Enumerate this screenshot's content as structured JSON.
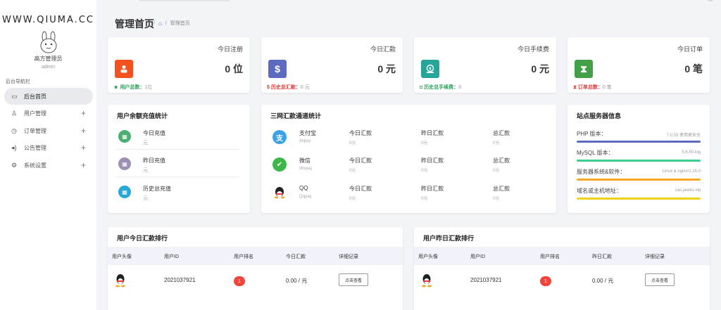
{
  "sidebar": {
    "brand": "WWW.QIUMA.CC",
    "admin_name": "高方管理员",
    "admin_role": "admin",
    "nav_caption": "后台导航栏",
    "items": [
      {
        "label": "后台首页",
        "icon": "monitor-icon"
      },
      {
        "label": "用户管理",
        "icon": "user-icon"
      },
      {
        "label": "订单管理",
        "icon": "clock-icon"
      },
      {
        "label": "公告管理",
        "icon": "speaker-icon"
      },
      {
        "label": "系统设置",
        "icon": "gear-icon"
      }
    ]
  },
  "header": {
    "title": "管理首页",
    "breadcrumb_sep": "/",
    "breadcrumb_current": "管理首页"
  },
  "stats": [
    {
      "label": "今日注册",
      "value": "0 位",
      "foot_key": "用户总数：",
      "foot_val": "1位",
      "color": "#f4511e",
      "foot_color": "#2e9e5b",
      "icon": "user-icon"
    },
    {
      "label": "今日汇款",
      "value": "0 元",
      "foot_key": "历史总汇款：",
      "foot_val": "0 元",
      "color": "#5c6bc0",
      "foot_color": "#e53935",
      "icon": "dollar-icon"
    },
    {
      "label": "今日手续费",
      "value": "0 元",
      "foot_key": "历史总手续费：",
      "foot_val": "0",
      "color": "#26a69a",
      "foot_color": "#2e9e5b",
      "icon": "money-icon"
    },
    {
      "label": "今日订单",
      "value": "0 笔",
      "foot_key": "订单总数：",
      "foot_val": "0 笔",
      "color": "#43a047",
      "foot_color": "#e53935",
      "icon": "hourglass-icon"
    }
  ],
  "recharge": {
    "title": "用户余额充值统计",
    "rows": [
      {
        "title": "今日充值",
        "sub": "元",
        "color": "#4caf72"
      },
      {
        "title": "昨日充值",
        "sub": "元",
        "color": "#9e8fb4"
      },
      {
        "title": "历史总充值",
        "sub": "元",
        "color": "#29a8d8"
      }
    ]
  },
  "payments": {
    "title": "三网汇款通道统计",
    "col_today": "今日汇款",
    "col_yesterday": "昨日汇款",
    "col_total": "总汇款",
    "rows": [
      {
        "name": "支付宝",
        "en": "Alipay",
        "today": "0元",
        "yesterday": "0元",
        "total": "0元",
        "color": "#1e88e5",
        "icon": "alipay-icon",
        "glyph": "支"
      },
      {
        "name": "微信",
        "en": "Wxpay",
        "today": "0元",
        "yesterday": "0元",
        "total": "0元",
        "color": "#3cb84a",
        "icon": "wechat-icon",
        "glyph": "✔"
      },
      {
        "name": "QQ",
        "en": "Qqpay",
        "today": "0元",
        "yesterday": "0元",
        "total": "0元",
        "color": "#222222",
        "icon": "qq-icon",
        "glyph": ""
      }
    ]
  },
  "server": {
    "title": "站点服务器信息",
    "rows": [
      {
        "key": "PHP 版本：",
        "value": "7.0.33 使用更安全",
        "color": "#5c6bc0"
      },
      {
        "key": "MySQL 版本：",
        "value": "5.6.50-log",
        "color": "#3ccf8e"
      },
      {
        "key": "服务器系统&软件：",
        "value": "Linux & nginx/1.15.0",
        "color": "#f5a623"
      },
      {
        "key": "域名或主机地址：",
        "value": "cas.yeeku.vip",
        "color": "#f1d21a"
      }
    ]
  },
  "rank_today": {
    "title": "用户今日汇款排行",
    "headers": [
      "用户头像",
      "用户ID",
      "用户排名",
      "今日汇款",
      "详细记录"
    ],
    "rows": [
      {
        "user_id": "2021037921",
        "rank": "1",
        "amount": "0.00 / 元",
        "button": "点击查看"
      }
    ]
  },
  "rank_yesterday": {
    "title": "用户昨日汇款排行",
    "headers": [
      "用户头像",
      "用户ID",
      "用户排名",
      "昨日汇款",
      "详细记录"
    ],
    "rows": [
      {
        "user_id": "2021037921",
        "rank": "1",
        "amount": "0.00 / 元",
        "button": "点击查看"
      }
    ]
  }
}
